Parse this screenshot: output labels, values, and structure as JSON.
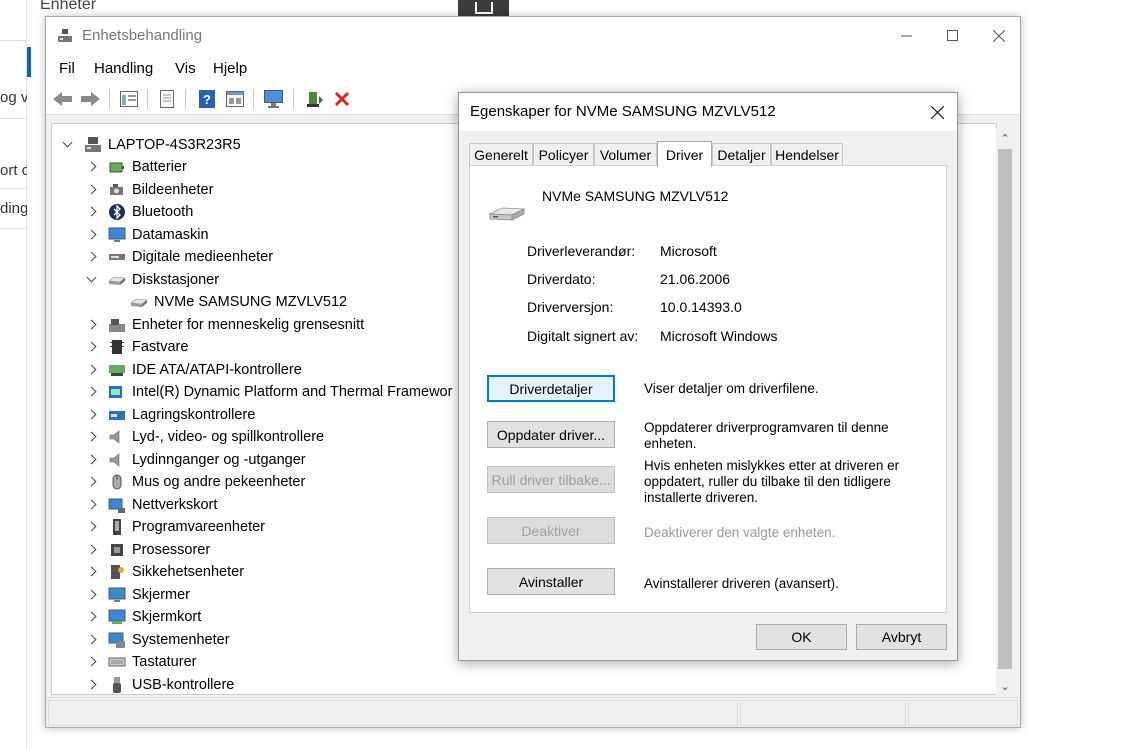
{
  "background": {
    "title": "Enheter",
    "fragments": [
      "og v",
      "ort o",
      "ding"
    ]
  },
  "window": {
    "title": "Enhetsbehandling",
    "menu": [
      "Fil",
      "Handling",
      "Vis",
      "Hjelp"
    ]
  },
  "tree": {
    "root": "LAPTOP-4S3R23R5",
    "items": [
      {
        "label": "Batterier",
        "state": "collapsed",
        "icon": "battery-icon"
      },
      {
        "label": "Bildeenheter",
        "state": "collapsed",
        "icon": "camera-icon"
      },
      {
        "label": "Bluetooth",
        "state": "collapsed",
        "icon": "bluetooth-icon"
      },
      {
        "label": "Datamaskin",
        "state": "collapsed",
        "icon": "computer-icon"
      },
      {
        "label": "Digitale medieenheter",
        "state": "collapsed",
        "icon": "media-device-icon"
      },
      {
        "label": "Diskstasjoner",
        "state": "expanded",
        "icon": "disk-drive-icon"
      },
      {
        "label": "NVMe SAMSUNG MZVLV512",
        "state": "child",
        "icon": "disk-drive-icon"
      },
      {
        "label": "Enheter for menneskelig grensesnitt",
        "state": "collapsed",
        "icon": "hid-icon"
      },
      {
        "label": "Fastvare",
        "state": "collapsed",
        "icon": "firmware-icon"
      },
      {
        "label": "IDE ATA/ATAPI-kontrollere",
        "state": "collapsed",
        "icon": "ide-controller-icon"
      },
      {
        "label": "Intel(R) Dynamic Platform and Thermal Framewor",
        "state": "collapsed",
        "icon": "thermal-framework-icon"
      },
      {
        "label": "Lagringskontrollere",
        "state": "collapsed",
        "icon": "storage-controller-icon"
      },
      {
        "label": "Lyd-, video- og spillkontrollere",
        "state": "collapsed",
        "icon": "speaker-icon"
      },
      {
        "label": "Lydinnganger og -utganger",
        "state": "collapsed",
        "icon": "speaker-icon"
      },
      {
        "label": "Mus og andre pekeenheter",
        "state": "collapsed",
        "icon": "mouse-icon"
      },
      {
        "label": "Nettverkskort",
        "state": "collapsed",
        "icon": "network-adapter-icon"
      },
      {
        "label": "Programvareenheter",
        "state": "collapsed",
        "icon": "software-device-icon"
      },
      {
        "label": "Prosessorer",
        "state": "collapsed",
        "icon": "processor-icon"
      },
      {
        "label": "Sikkehetsenheter",
        "state": "collapsed",
        "icon": "security-device-icon"
      },
      {
        "label": "Skjermer",
        "state": "collapsed",
        "icon": "monitor-icon"
      },
      {
        "label": "Skjermkort",
        "state": "collapsed",
        "icon": "display-adapter-icon"
      },
      {
        "label": "Systemenheter",
        "state": "collapsed",
        "icon": "system-device-icon"
      },
      {
        "label": "Tastaturer",
        "state": "collapsed",
        "icon": "keyboard-icon"
      },
      {
        "label": "USB-kontrollere",
        "state": "collapsed",
        "icon": "usb-icon"
      }
    ]
  },
  "dialog": {
    "title": "Egenskaper for NVMe SAMSUNG MZVLV512",
    "tabs": [
      "Generelt",
      "Policyer",
      "Volumer",
      "Driver",
      "Detaljer",
      "Hendelser"
    ],
    "active_tab": "Driver",
    "device_name": "NVMe SAMSUNG MZVLV512",
    "props": [
      {
        "label": "Driverleverandør:",
        "value": "Microsoft"
      },
      {
        "label": "Driverdato:",
        "value": "21.06.2006"
      },
      {
        "label": "Driverversjon:",
        "value": "10.0.14393.0"
      },
      {
        "label": "Digitalt signert av:",
        "value": "Microsoft Windows"
      }
    ],
    "actions": [
      {
        "button": "Driverdetaljer",
        "desc": "Viser detaljer om driverfilene.",
        "enabled": true
      },
      {
        "button": "Oppdater driver...",
        "desc": "Oppdaterer driverprogramvaren til denne enheten.",
        "enabled": true
      },
      {
        "button": "Rull driver tilbake...",
        "desc": "Hvis enheten mislykkes etter at driveren er oppdatert, ruller du tilbake til den tidligere installerte driveren.",
        "enabled": false
      },
      {
        "button": "Deaktiver",
        "desc": "Deaktiverer den valgte enheten.",
        "enabled": false
      },
      {
        "button": "Avinstaller",
        "desc": "Avinstallerer driveren (avansert).",
        "enabled": true
      }
    ],
    "ok": "OK",
    "cancel": "Avbryt"
  }
}
